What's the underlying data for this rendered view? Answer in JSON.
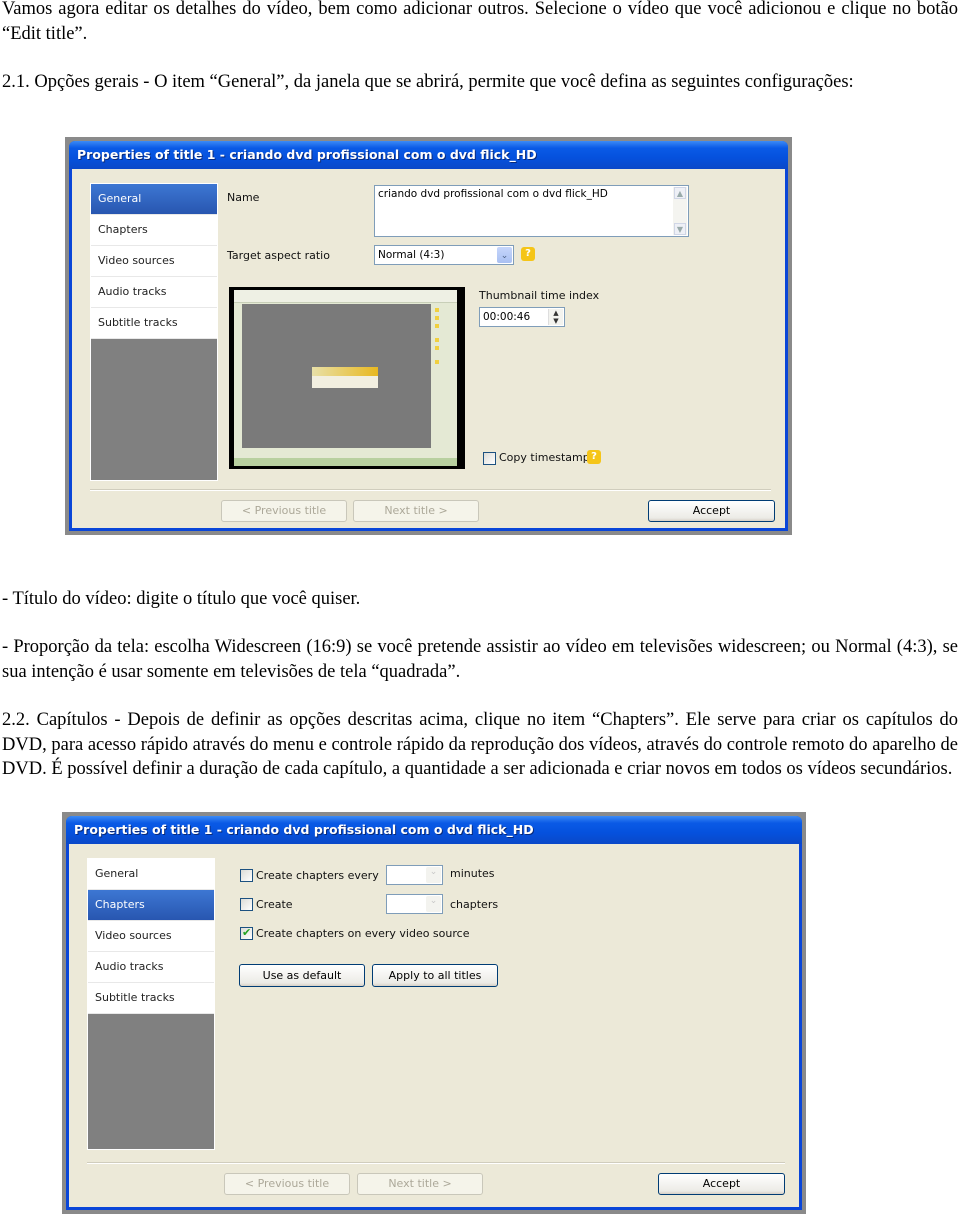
{
  "paragraphs": {
    "intro": "Vamos agora editar os detalhes do vídeo, bem como adicionar outros. Selecione o vídeo que você adicionou e clique no botão “Edit title”.",
    "section_2_1": "2.1. Opções gerais - O item “General”, da janela que se abrirá, permite que você defina as seguintes configurações:",
    "titulo": "- Título do vídeo: digite o título que você quiser.",
    "proporcao": "- Proporção da tela: escolha Widescreen (16:9) se você pretende assistir ao vídeo em televisões widescreen; ou Normal (4:3), se sua intenção é usar somente em televisões de tela “quadrada”.",
    "section_2_2": "2.2. Capítulos - Depois de definir as opções descritas acima, clique no item “Chapters”. Ele serve para criar os capítulos do DVD, para acesso rápido através do menu e controle rápido da reprodução dos vídeos, através do controle remoto do aparelho de DVD. É possível definir a duração de cada capítulo, a quantidade a ser adicionada e criar novos em todos os vídeos secundários."
  },
  "sidebar_items": [
    "General",
    "Chapters",
    "Video sources",
    "Audio tracks",
    "Subtitle tracks"
  ],
  "dialog_general": {
    "title": "Properties of title 1 - criando dvd profissional com o dvd flick_HD",
    "active_item": "General",
    "name_label": "Name",
    "name_value": "criando dvd profissional com o dvd flick_HD",
    "aspect_label": "Target aspect ratio",
    "aspect_value": "Normal (4:3)",
    "thumb_label": "Thumbnail time index",
    "thumb_value": "00:00:46",
    "copy_timestamps_label": "Copy timestamps",
    "copy_timestamps_checked": false,
    "help_glyph": "?",
    "prev_button": "< Previous title",
    "next_button": "Next title >",
    "accept_button": "Accept"
  },
  "dialog_chapters": {
    "title": "Properties of title 1 - criando dvd profissional com o dvd flick_HD",
    "active_item": "Chapters",
    "create_every_label": "Create chapters every",
    "create_every_checked": false,
    "create_every_value": "",
    "minutes_label": "minutes",
    "create_label": "Create",
    "create_checked": false,
    "create_value": "",
    "chapters_label": "chapters",
    "every_source_label": "Create chapters on every video source",
    "every_source_checked": true,
    "use_default_button": "Use as default",
    "apply_all_button": "Apply to all titles",
    "prev_button": "< Previous title",
    "next_button": "Next title >",
    "accept_button": "Accept"
  },
  "icons": {
    "scroll_up": "▲",
    "scroll_down": "▼",
    "dropdown": "⌄",
    "spin_up": "▲",
    "spin_down": "▼"
  }
}
